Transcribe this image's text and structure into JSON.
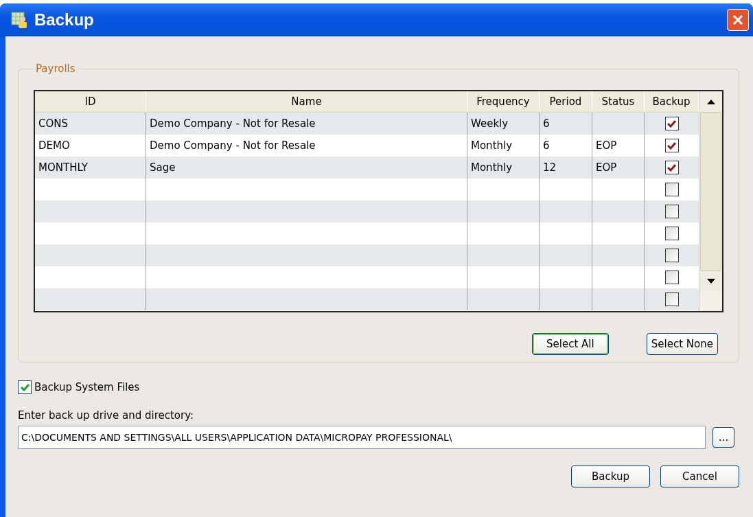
{
  "window": {
    "title": "Backup"
  },
  "payrolls": {
    "label": "Payrolls",
    "columns": [
      "ID",
      "Name",
      "Frequency",
      "Period",
      "Status",
      "Backup"
    ],
    "rows": [
      {
        "id": "CONS",
        "name": "Demo Company - Not for Resale",
        "frequency": "Weekly",
        "period": "6",
        "backup": true
      },
      {
        "id": "DEMO",
        "name": "Demo Company - Not for Resale",
        "frequency": "Monthly",
        "period": "6",
        "status": "EOP",
        "backup": true
      },
      {
        "id": "MONTHLY",
        "name": "Sage",
        "frequency": "Monthly",
        "period": "12",
        "status": "EOP",
        "backup": true
      },
      {
        "backup": false
      },
      {
        "backup": false
      },
      {
        "backup": false
      },
      {
        "backup": false
      },
      {
        "backup": false
      },
      {
        "backup": false
      }
    ],
    "buttons": [
      {
        "label": "Select All",
        "default": true
      },
      {
        "label": "Select None",
        "default": false
      }
    ]
  },
  "system_files": {
    "label": "Backup System Files",
    "checked": true
  },
  "directory": {
    "label": "Enter back up drive and directory:",
    "value": "C:\\DOCUMENTS AND SETTINGS\\ALL USERS\\APPLICATION DATA\\MICROPAY PROFESSIONAL\\",
    "browse": "..."
  },
  "buttons": [
    {
      "label": "Backup"
    },
    {
      "label": "Cancel"
    }
  ]
}
